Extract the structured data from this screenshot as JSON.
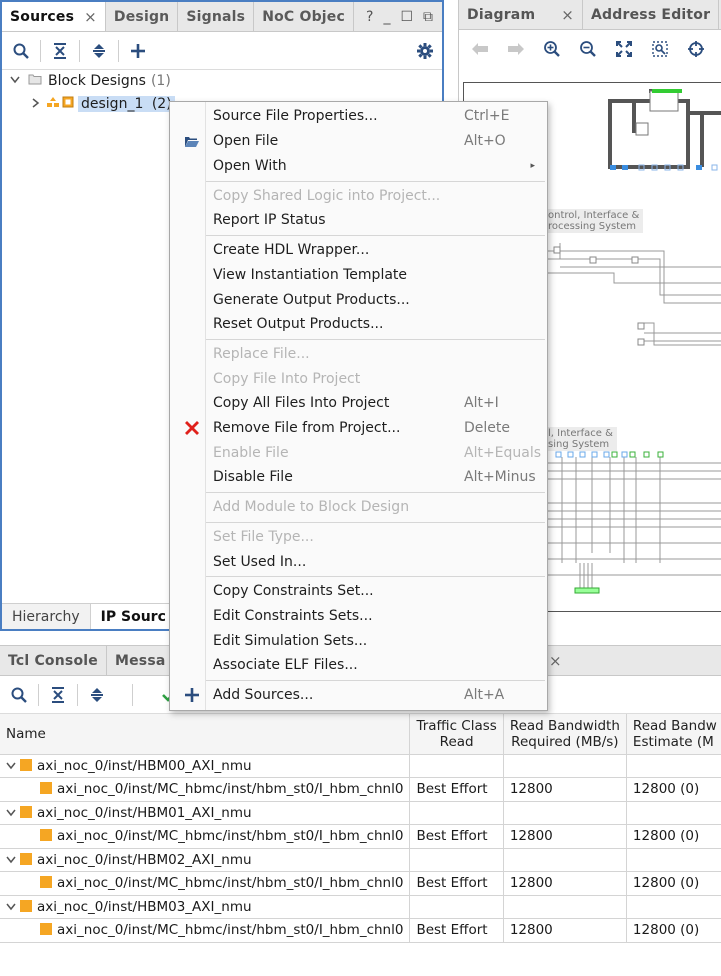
{
  "sources_tabs": [
    {
      "label": "Sources",
      "close": "×"
    },
    {
      "label": "Design"
    },
    {
      "label": "Signals"
    },
    {
      "label": "NoC Objec"
    }
  ],
  "sources_window_buttons": {
    "help": "?",
    "minimize": "_",
    "maximize": "☐",
    "float": "⧉"
  },
  "sources_tree": {
    "group_label": "Block Designs",
    "group_count": "(1)",
    "item_label": "design_1",
    "item_count": "(2)"
  },
  "sources_bottom_tabs": [
    "Hierarchy",
    "IP Sourc"
  ],
  "diagram_tabs": [
    {
      "label": "Diagram",
      "close": "×"
    },
    {
      "label": "Address Editor"
    }
  ],
  "diagram_labels": {
    "label1_line1": "ontrol, Interface &",
    "label1_line2": "rocessing System",
    "label2_line1": "l, Interface &",
    "label2_line2": "sing System"
  },
  "context_menu": {
    "items": [
      {
        "label": "Source File Properties...",
        "shortcut": "Ctrl+E"
      },
      {
        "label": "Open File",
        "shortcut": "Alt+O",
        "icon": "folder-open-icon"
      },
      {
        "label": "Open With",
        "submenu": "▸"
      },
      {
        "label": "Copy Shared Logic into Project...",
        "disabled": true
      },
      {
        "label": "Report IP Status"
      },
      {
        "label": "Create HDL Wrapper..."
      },
      {
        "label": "View Instantiation Template"
      },
      {
        "label": "Generate Output Products..."
      },
      {
        "label": "Reset Output Products..."
      },
      {
        "label": "Replace File...",
        "disabled": true
      },
      {
        "label": "Copy File Into Project",
        "disabled": true
      },
      {
        "label": "Copy All Files Into Project",
        "shortcut": "Alt+I"
      },
      {
        "label": "Remove File from Project...",
        "shortcut": "Delete",
        "icon": "remove-x-icon"
      },
      {
        "label": "Enable File",
        "shortcut": "Alt+Equals",
        "disabled": true
      },
      {
        "label": "Disable File",
        "shortcut": "Alt+Minus"
      },
      {
        "label": "Add Module to Block Design",
        "disabled": true
      },
      {
        "label": "Set File Type...",
        "disabled": true
      },
      {
        "label": "Set Used In..."
      },
      {
        "label": "Copy Constraints Set..."
      },
      {
        "label": "Edit Constraints Sets..."
      },
      {
        "label": "Edit Simulation Sets..."
      },
      {
        "label": "Associate ELF Files..."
      },
      {
        "label": "Add Sources...",
        "shortcut": "Alt+A",
        "icon": "plus-icon"
      }
    ]
  },
  "bottom_tabs": [
    {
      "label": "Tcl Console"
    },
    {
      "label": "Messa"
    }
  ],
  "bottom_tab_close": "×",
  "noc_table": {
    "headers": [
      {
        "line1": "Name",
        "line2": ""
      },
      {
        "line1": "Traffic Class",
        "line2": "Read"
      },
      {
        "line1": "Read Bandwidth",
        "line2": "Required (MB/s)"
      },
      {
        "line1": "Read Bandw",
        "line2": "Estimate (M"
      }
    ],
    "rows": [
      {
        "level": 0,
        "name": "axi_noc_0/inst/HBM00_AXI_nmu",
        "traffic": "",
        "required": "",
        "estimate": ""
      },
      {
        "level": 1,
        "name": "axi_noc_0/inst/MC_hbmc/inst/hbm_st0/I_hbm_chnl0",
        "traffic": "Best Effort",
        "required": "12800",
        "estimate": "12800 (0)"
      },
      {
        "level": 0,
        "name": "axi_noc_0/inst/HBM01_AXI_nmu",
        "traffic": "",
        "required": "",
        "estimate": ""
      },
      {
        "level": 1,
        "name": "axi_noc_0/inst/MC_hbmc/inst/hbm_st0/I_hbm_chnl0",
        "traffic": "Best Effort",
        "required": "12800",
        "estimate": "12800 (0)"
      },
      {
        "level": 0,
        "name": "axi_noc_0/inst/HBM02_AXI_nmu",
        "traffic": "",
        "required": "",
        "estimate": ""
      },
      {
        "level": 1,
        "name": "axi_noc_0/inst/MC_hbmc/inst/hbm_st0/I_hbm_chnl0",
        "traffic": "Best Effort",
        "required": "12800",
        "estimate": "12800 (0)"
      },
      {
        "level": 0,
        "name": "axi_noc_0/inst/HBM03_AXI_nmu",
        "traffic": "",
        "required": "",
        "estimate": ""
      },
      {
        "level": 1,
        "name": "axi_noc_0/inst/MC_hbmc/inst/hbm_st0/I_hbm_chnl0",
        "traffic": "Best Effort",
        "required": "12800",
        "estimate": "12800 (0)"
      }
    ]
  },
  "colors": {
    "accent_border": "#4a7ec2",
    "selection": "#c9ddf5",
    "remove_red": "#e0201b",
    "ip_orange": "#f5a623",
    "check_green": "#2ea043"
  }
}
